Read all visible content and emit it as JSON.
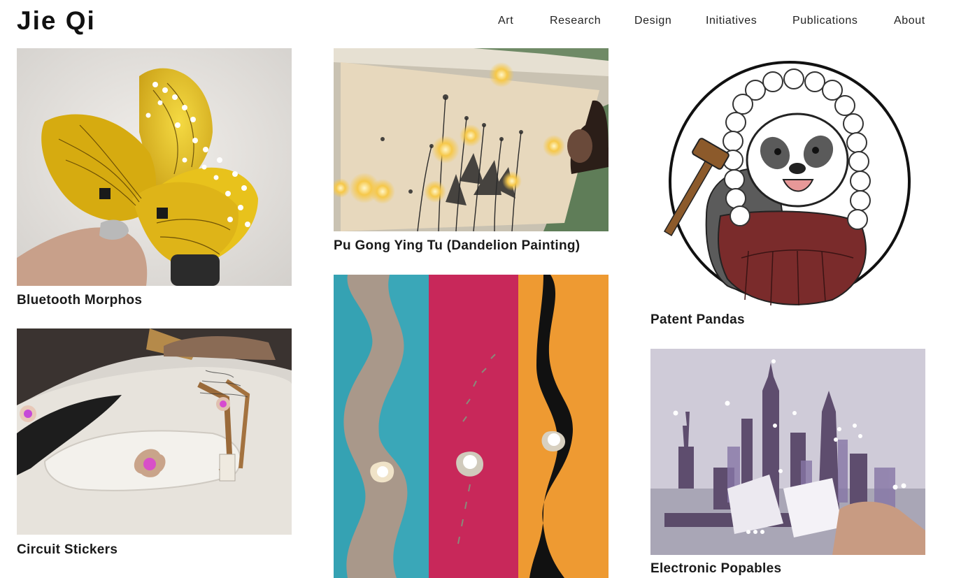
{
  "site": {
    "title": "Jie Qi"
  },
  "nav": [
    {
      "label": "Art"
    },
    {
      "label": "Research"
    },
    {
      "label": "Design"
    },
    {
      "label": "Initiatives"
    },
    {
      "label": "Publications"
    },
    {
      "label": "About"
    }
  ],
  "projects": [
    {
      "title": "Bluetooth Morphos"
    },
    {
      "title": "Circuit Stickers"
    },
    {
      "title": "Pu Gong Ying Tu (Dandelion Painting)"
    },
    {
      "title": "Patent Pandas"
    },
    {
      "title": "Electronic Popables"
    }
  ],
  "colors": {
    "text": "#111111",
    "background": "#ffffff"
  }
}
